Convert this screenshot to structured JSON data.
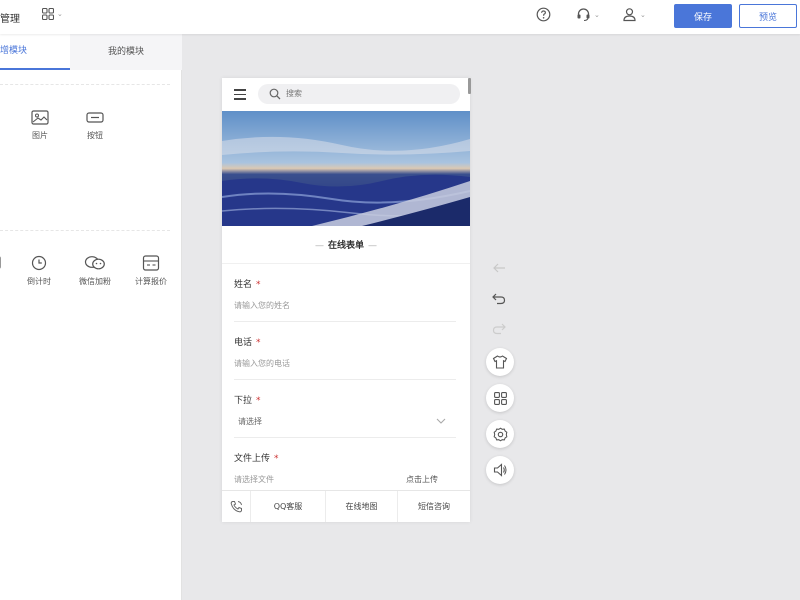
{
  "topbar": {
    "title": "管理",
    "apps_caret": "⌄",
    "headset_caret": "⌄",
    "user_caret": "⌄",
    "save_label": "保存",
    "preview_label": "预览"
  },
  "sidebar": {
    "tabs": [
      {
        "label": "新增模块",
        "active": true
      },
      {
        "label": "我的模块",
        "active": false
      }
    ],
    "row1": [
      {
        "label": "图片",
        "icon": "image-icon"
      },
      {
        "label": "按钮",
        "icon": "button-icon"
      }
    ],
    "row2": [
      {
        "label": "倒计时",
        "icon": "clock-icon"
      },
      {
        "label": "微信加粉",
        "icon": "wechat-icon"
      },
      {
        "label": "计算报价",
        "icon": "calculator-icon"
      }
    ]
  },
  "phone": {
    "search_placeholder": "搜索",
    "form_title": "在线表单",
    "form_title_left_dash": "—",
    "form_title_right_dash": "—",
    "fields": [
      {
        "label": "姓名",
        "required": "*",
        "placeholder": "请输入您的姓名"
      },
      {
        "label": "电话",
        "required": "*",
        "placeholder": "请输入您的电话"
      },
      {
        "label": "下拉",
        "required": "*",
        "placeholder": "请选择"
      },
      {
        "label": "文件上传",
        "required": "*",
        "placeholder": "请选择文件",
        "button": "点击上传"
      }
    ],
    "bottom_bar": [
      "QQ客服",
      "在线地图",
      "短信咨询"
    ]
  },
  "colors": {
    "accent": "#4a76d9",
    "canvas_bg": "#e8e8ea",
    "required": "#cc3333"
  },
  "side_tools": [
    "back-arrow-icon",
    "undo-icon",
    "redo-icon",
    "shirt-icon",
    "grid-icon",
    "gear-icon",
    "speaker-icon"
  ]
}
